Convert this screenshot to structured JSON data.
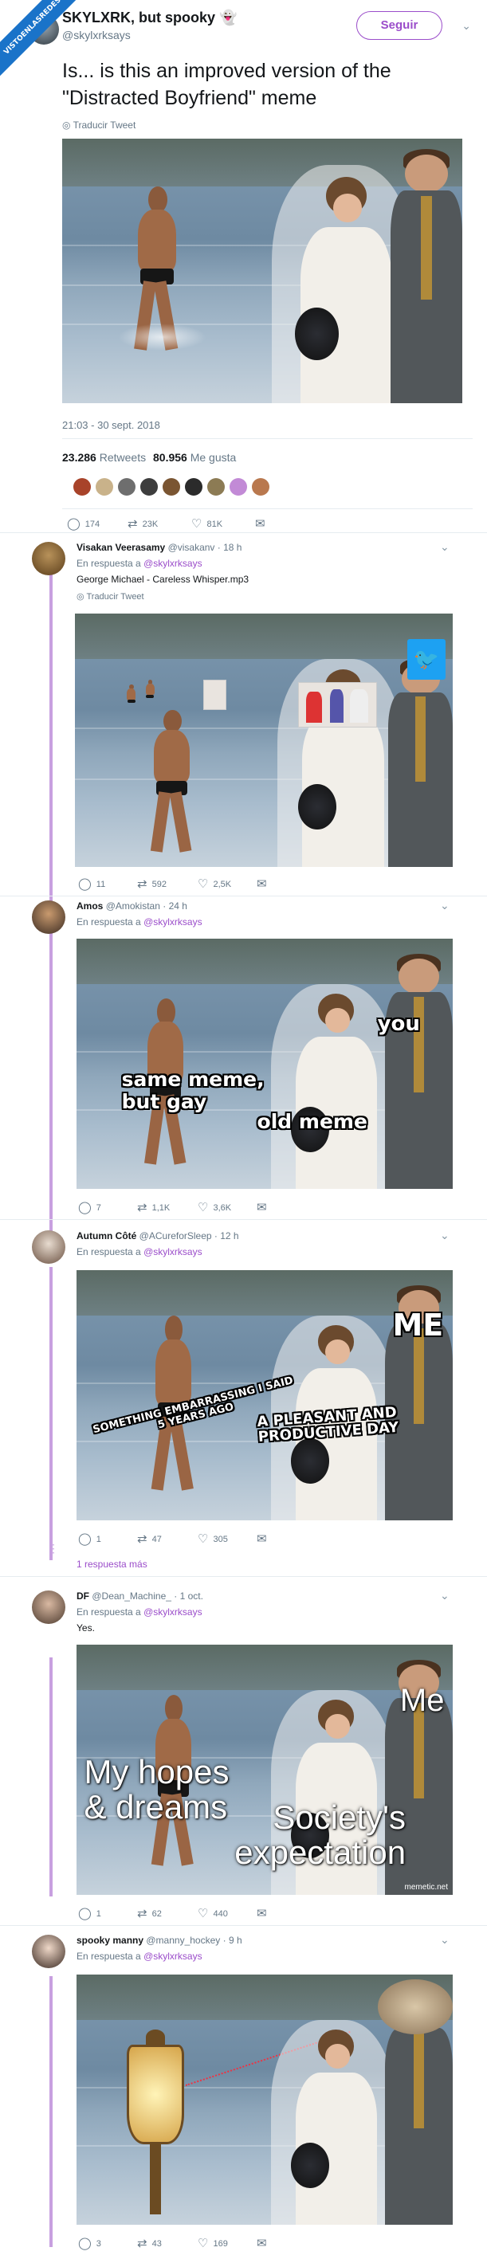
{
  "watermark": "VISTOENLASREDES",
  "main_tweet": {
    "display_name": "SKYLXRK, but spooky",
    "name_emoji": "👻",
    "handle": "@skylxrksays",
    "follow_label": "Seguir",
    "text": "Is... is this an improved version of the \"Distracted Boyfriend\" meme",
    "translate": "Traducir Tweet",
    "timestamp": "21:03 - 30 sept. 2018",
    "retweets_count": "23.286",
    "retweets_label": "Retweets",
    "likes_count": "80.956",
    "likes_label": "Me gusta",
    "replies": "174",
    "rts": "23K",
    "favs": "81K"
  },
  "replies": [
    {
      "name": "Visakan Veerasamy",
      "handle": "@visakanv",
      "time": "· 18 h",
      "reply_prefix": "En respuesta a",
      "reply_to": "@skylxrksays",
      "text": "George Michael - Careless Whisper.mp3",
      "translate": "Traducir Tweet",
      "replies": "11",
      "rts": "592",
      "favs": "2,5K"
    },
    {
      "name": "Amos",
      "handle": "@Amokistan",
      "time": "· 24 h",
      "reply_prefix": "En respuesta a",
      "reply_to": "@skylxrksays",
      "meme_you": "you",
      "meme_same": "same meme,\nbut gay",
      "meme_old": "old meme",
      "replies": "7",
      "rts": "1,1K",
      "favs": "3,6K"
    },
    {
      "name": "Autumn Côté",
      "handle": "@ACureforSleep",
      "time": "· 12 h",
      "reply_prefix": "En respuesta a",
      "reply_to": "@skylxrksays",
      "meme_me": "ME",
      "meme_embarrassing": "SOMETHING EMBARRASSING I SAID\n5 YEARS AGO",
      "meme_pleasant": "A PLEASANT AND\nPRODUCTIVE DAY",
      "replies": "1",
      "rts": "47",
      "favs": "305",
      "more": "1 respuesta más"
    },
    {
      "name": "DF",
      "handle": "@Dean_Machine_",
      "time": "· 1 oct.",
      "reply_prefix": "En respuesta a",
      "reply_to": "@skylxrksays",
      "text": "Yes.",
      "meme_me": "Me",
      "meme_hopes": "My hopes\n& dreams",
      "meme_society": "Society's\nexpectation",
      "meme_credit": "memetic.net",
      "replies": "1",
      "rts": "62",
      "favs": "440"
    },
    {
      "name": "spooky manny",
      "handle": "@manny_hockey",
      "time": "· 9 h",
      "reply_prefix": "En respuesta a",
      "reply_to": "@skylxrksays",
      "replies": "3",
      "rts": "43",
      "favs": "169"
    }
  ],
  "icons": {
    "reply": "speech-bubble-icon",
    "retweet": "retweet-icon",
    "like": "heart-icon",
    "dm": "envelope-icon",
    "chevron": "chevron-down-icon",
    "globe": "globe-icon"
  },
  "colors": {
    "accent": "#9b4dca",
    "thread_line": "#c8a0e0",
    "muted": "#657786",
    "twitter_blue": "#1da1f2"
  }
}
